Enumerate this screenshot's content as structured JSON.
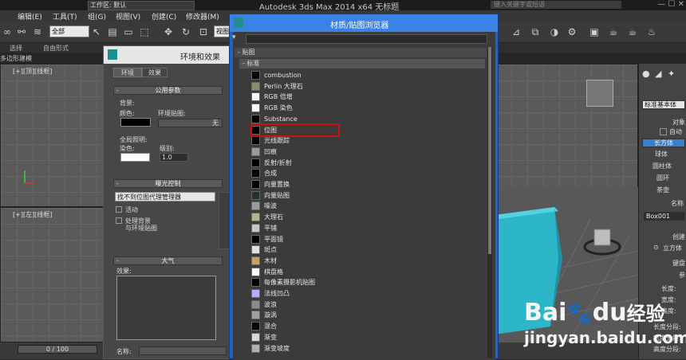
{
  "window": {
    "title": "Autodesk 3ds Max  2014 x64     无标题",
    "workspace": "工作区: 默认",
    "search_placeholder": "键入关键字或短语"
  },
  "menubar": [
    "编辑(E)",
    "工具(T)",
    "组(G)",
    "视图(V)",
    "创建(C)",
    "修改器(M)"
  ],
  "toolbar": {
    "selection_filter": "全部",
    "view_select": "视图"
  },
  "ribbon": {
    "tab_1": "选择",
    "tab_2": "自由形式",
    "sub_label": "多边形建模"
  },
  "viewports": {
    "top_left": "[+][顶][线框]",
    "mid_left": "[+][左][线框]",
    "progress": "0 / 100"
  },
  "command_panel": {
    "category": "标准基本体",
    "rollout_object": "对象",
    "autogrid": "自动",
    "buttons": [
      "长方体",
      "球体",
      "圆柱体",
      "圆环",
      "茶壶"
    ],
    "name_header": "名称",
    "name_value": "Box001",
    "creation_header": "创建",
    "creation_option": "立方体",
    "keyboard_header": "键盘",
    "params_header": "参",
    "param_labels": [
      "长度:",
      "宽度:",
      "高度:",
      "长度分段:",
      "宽度分段:",
      "高度分段:"
    ]
  },
  "env_dialog": {
    "title": "环境和效果",
    "tabs": [
      "环境",
      "效果"
    ],
    "rollout_common": "公用参数",
    "background_label": "背景:",
    "color_label": "颜色:",
    "env_map_label": "环境贴图:",
    "none_label": "无",
    "global_lighting": "全局照明:",
    "tint_label": "染色:",
    "level_label": "级别:",
    "level_value": "1.0",
    "rollout_exposure": "曝光控制",
    "exposure_select": "找不到位图代理管理器",
    "active_label": "活动",
    "process_bg_1": "处理背景",
    "process_bg_2": "与环境贴图",
    "rollout_atmos": "大气",
    "effects_label": "效果:",
    "name_label": "名称:"
  },
  "mat_browser": {
    "title": "材质/贴图浏览器",
    "group_maps": "- 贴图",
    "group_standard": "- 标准",
    "items": [
      {
        "name": "combustion",
        "swatch": "#000000"
      },
      {
        "name": "Perlin 大理石",
        "swatch": "#8c8c6a"
      },
      {
        "name": "RGB 倍增",
        "swatch": "#ffffff"
      },
      {
        "name": "RGB 染色",
        "swatch": "#ffffff"
      },
      {
        "name": "Substance",
        "swatch": "#000000"
      },
      {
        "name": "位图",
        "swatch": "#000000"
      },
      {
        "name": "光线跟踪",
        "swatch": "#000000"
      },
      {
        "name": "凹痕",
        "swatch": "#9a9a9a"
      },
      {
        "name": "反射/折射",
        "swatch": "#000000"
      },
      {
        "name": "合成",
        "swatch": "#000000"
      },
      {
        "name": "向量置换",
        "swatch": "#000000"
      },
      {
        "name": "向量贴图",
        "swatch": "#223322"
      },
      {
        "name": "噪波",
        "swatch": "#9b9b9b"
      },
      {
        "name": "大理石",
        "swatch": "#b8b090"
      },
      {
        "name": "平铺",
        "swatch": "#c8c8c8"
      },
      {
        "name": "平面镜",
        "swatch": "#000000"
      },
      {
        "name": "斑点",
        "swatch": "#e0e0e0"
      },
      {
        "name": "木材",
        "swatch": "#c8a060"
      },
      {
        "name": "棋盘格",
        "swatch": "#ffffff"
      },
      {
        "name": "每像素摄影机贴图",
        "swatch": "#000000"
      },
      {
        "name": "法线凹凸",
        "swatch": "#b0b0ff"
      },
      {
        "name": "波浪",
        "swatch": "#8a8a8a"
      },
      {
        "name": "漩涡",
        "swatch": "#a0a0a0"
      },
      {
        "name": "混合",
        "swatch": "#000000"
      },
      {
        "name": "渐变",
        "swatch": "#d8d8d8"
      },
      {
        "name": "渐变坡度",
        "swatch": "#b0b0b0"
      }
    ]
  },
  "watermark": {
    "brand": "Bai",
    "logo_glyph": "🐾",
    "brand_tail": "du",
    "brand_cn": "经验",
    "url": "jingyan.baidu.com"
  },
  "colors": {
    "accent_blue": "#3a82e6",
    "highlight_red": "#d01010",
    "box_cyan": "#2cb6c8"
  }
}
